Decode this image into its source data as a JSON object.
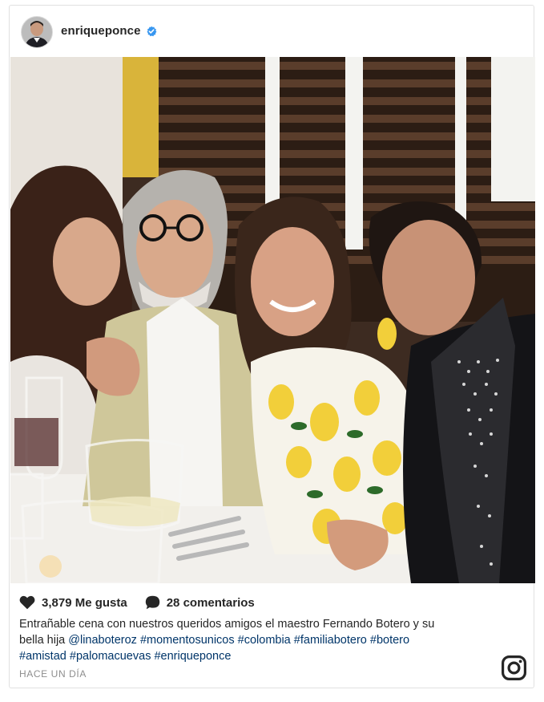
{
  "post": {
    "username": "enriqueponce",
    "verified": true,
    "likes_label": "3,879 Me gusta",
    "comments_label": "28 comentarios",
    "caption": {
      "line1": "Entrañable cena con nuestros queridos amigos el maestro Fernando Botero y su",
      "line2_text": "bella hija ",
      "mention": "@linaboteroz",
      "tags_line2": [
        "#momentosunicos",
        "#colombia",
        "#familiabotero",
        "#botero"
      ],
      "tags_line3": [
        "#amistad",
        "#palomacuevas",
        "#enriqueponce"
      ]
    },
    "timestamp": "HACE UN DÍA"
  },
  "icons": {
    "avatar": "avatar",
    "verified": "verified-badge-icon",
    "like": "heart-icon",
    "comment": "comment-bubble-icon",
    "brand": "instagram-logo-icon"
  },
  "colors": {
    "text": "#262626",
    "link": "#003569",
    "muted": "#8e8e8e",
    "verified": "#3897f0",
    "border": "#e1e1e1"
  }
}
